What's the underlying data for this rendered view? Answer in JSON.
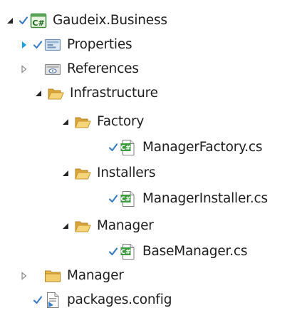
{
  "solution_explorer": {
    "project": {
      "label": "Gaudeix.Business",
      "icon": "csharp-project-icon"
    },
    "items": [
      {
        "label": "Properties",
        "icon": "properties-folder-icon"
      },
      {
        "label": "References",
        "icon": "references-icon"
      },
      {
        "label": "Infrastructure",
        "icon": "folder-open-icon"
      },
      {
        "label": "Factory",
        "icon": "folder-open-icon"
      },
      {
        "label": "ManagerFactory.cs",
        "icon": "csharp-file-icon"
      },
      {
        "label": "Installers",
        "icon": "folder-open-icon"
      },
      {
        "label": "ManagerInstaller.cs",
        "icon": "csharp-file-icon"
      },
      {
        "label": "Manager",
        "icon": "folder-open-icon"
      },
      {
        "label": "BaseManager.cs",
        "icon": "csharp-file-icon"
      },
      {
        "label": "Manager",
        "icon": "folder-closed-icon"
      },
      {
        "label": "packages.config",
        "icon": "config-file-icon"
      }
    ]
  },
  "colors": {
    "check": "#3d7ec4",
    "arrow_expanded": "#262626",
    "arrow_collapsed": "#8a8a8a",
    "arrow_hover": "#1ba1e2",
    "folder": "#e8b94a",
    "csharp_green": "#2f8f2f"
  }
}
